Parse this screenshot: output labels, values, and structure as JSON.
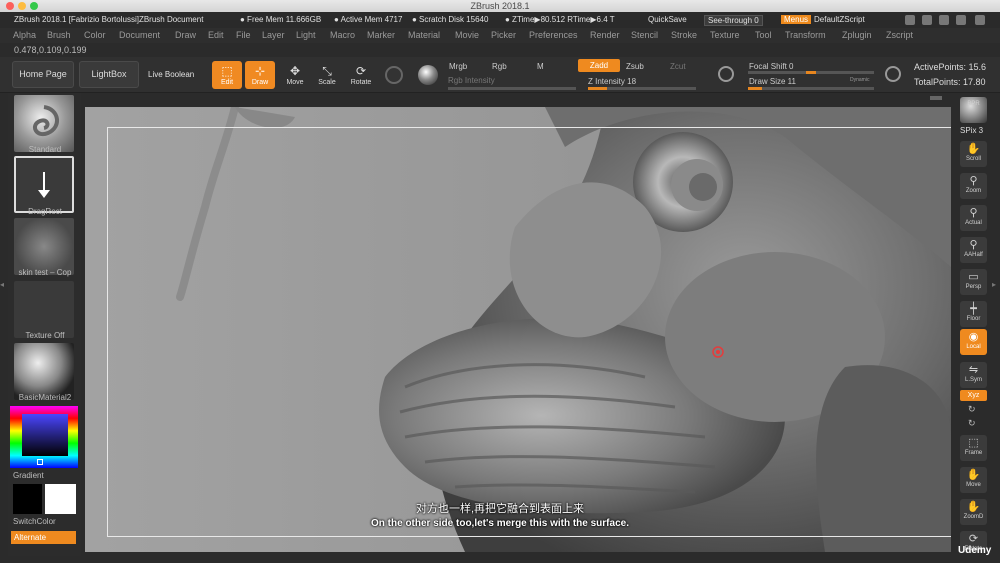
{
  "window": {
    "title": "ZBrush 2018.1",
    "traffic_colors": [
      "#fc605c",
      "#fdbc40",
      "#34c84a"
    ]
  },
  "info_bar": {
    "doc_title": "ZBrush 2018.1 [Fabrizio Bortolussi]ZBrush Document",
    "free_mem": "● Free Mem 11.666GB",
    "active_mem": "● Active Mem 4717",
    "scratch_disk": "● Scratch Disk 15640",
    "ztime": "● ZTime▶80.512 RTime▶6.4 T",
    "quicksave": "QuickSave",
    "see_through": "See-through  0",
    "menus": "Menus",
    "default_script": "DefaultZScript"
  },
  "menu": [
    "Alpha",
    "Brush",
    "Color",
    "Document",
    "Draw",
    "Edit",
    "File",
    "Layer",
    "Light",
    "Macro",
    "Marker",
    "Material",
    "Movie",
    "Picker",
    "Preferences",
    "Render",
    "Stencil",
    "Stroke",
    "Texture",
    "Tool",
    "Transform",
    "Zplugin",
    "Zscript"
  ],
  "coordinates": "0.478,0.109,0.199",
  "toolbar": {
    "home_page": "Home Page",
    "lightbox": "LightBox",
    "live_boolean": "Live Boolean",
    "edit": "Edit",
    "draw": "Draw",
    "move": "Move",
    "scale": "Scale",
    "rotate": "Rotate",
    "mrgb": "Mrgb",
    "rgb": "Rgb",
    "m": "M",
    "zadd": "Zadd",
    "zsub": "Zsub",
    "zcut": "Zcut",
    "rgb_intensity": "Rgb Intensity",
    "z_intensity": "Z Intensity 18",
    "focal_shift": "Focal Shift 0",
    "draw_size": "Draw Size 11",
    "dynamic": "Dynamic",
    "active_points": "ActivePoints: 15.6",
    "total_points": "TotalPoints: 17.80",
    "z_intensity_value": 18,
    "draw_size_value": 11
  },
  "left_shelf": {
    "brush": "Standard",
    "stroke": "DragRect",
    "alpha": "skin test – Cop",
    "texture": "Texture Off",
    "material": "BasicMaterial2",
    "gradient": "Gradient",
    "switch_color": "SwitchColor",
    "alternate": "Alternate"
  },
  "right_shelf": {
    "bpr": "BPR",
    "spix": "SPix 3",
    "items": [
      "Scroll",
      "Zoom",
      "Actual",
      "AAHalf",
      "Persp",
      "Floor",
      "Local",
      "L.Sym",
      "Xyz",
      "Frame",
      "Move",
      "ZoomD",
      "Rotate"
    ]
  },
  "subtitles": {
    "zh": "对方也一样,再把它融合到表面上来",
    "en": "On the other side too,let's merge this with the surface."
  },
  "watermark": "Udemy"
}
